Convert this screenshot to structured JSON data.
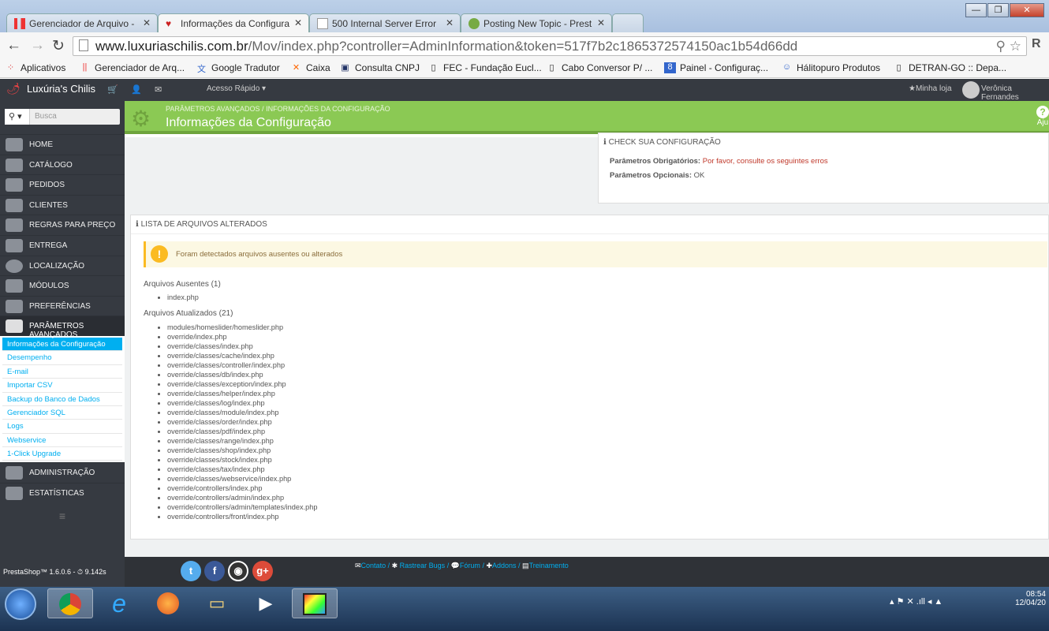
{
  "browser": {
    "tabs": [
      {
        "title": "Gerenciador de Arquivo -",
        "active": false
      },
      {
        "title": "Informações da Configura",
        "active": true
      },
      {
        "title": "500 Internal Server Error",
        "active": false
      },
      {
        "title": "Posting New Topic - Prest",
        "active": false
      }
    ],
    "url_host": "www.luxuriaschilis.com.br",
    "url_path": "/Mov/index.php?controller=AdminInformation&token=517f7b2c1865372574150ac1b54d66dd",
    "bookmarks": [
      "Aplicativos",
      "Gerenciador de Arq...",
      "Google Tradutor",
      "Caixa",
      "Consulta CNPJ",
      "FEC - Fundação Eucl...",
      "Cabo Conversor P/ ...",
      "Painel - Configuraç...",
      "Hálitopuro Produtos",
      "DETRAN-GO :: Depa..."
    ]
  },
  "header": {
    "shop_name": "Luxúria's Chilis",
    "quick_access": "Acesso Rápido ▾",
    "my_shop": "Minha loja",
    "user": "Verônica Fernandes"
  },
  "sidebar": {
    "search_placeholder": "Busca",
    "items": [
      "HOME",
      "CATÁLOGO",
      "PEDIDOS",
      "CLIENTES",
      "REGRAS PARA PREÇO",
      "ENTREGA",
      "LOCALIZAÇÃO",
      "MÓDULOS",
      "PREFERÊNCIAS",
      "PARÂMETROS AVANÇADOS"
    ],
    "subitems": [
      "Informações da Configuração",
      "Desempenho",
      "E-mail",
      "Importar CSV",
      "Backup do Banco de Dados",
      "Gerenciador SQL",
      "Logs",
      "Webservice",
      "1-Click Upgrade"
    ],
    "items_after": [
      "ADMINISTRAÇÃO",
      "ESTATÍSTICAS"
    ]
  },
  "page": {
    "breadcrumb1": "PARÂMETROS AVANÇADOS",
    "breadcrumb_sep": "/",
    "breadcrumb2": "INFORMAÇÕES DA CONFIGURAÇÃO",
    "title": "Informações da Configuração",
    "help": "Aju",
    "check_title": "CHECK SUA CONFIGURAÇÃO",
    "required_label": "Parâmetros Obrigatórios:",
    "required_value": "Por favor, consulte os seguintes erros",
    "optional_label": "Parâmetros Opcionais:",
    "optional_value": "OK",
    "list_title": "LISTA DE ARQUIVOS ALTERADOS",
    "warning": "Foram detectados arquivos ausentes ou alterados",
    "missing_title": "Arquivos Ausentes (1)",
    "missing": [
      "index.php"
    ],
    "updated_title": "Arquivos Atualizados (21)",
    "updated": [
      "modules/homeslider/homeslider.php",
      "override/index.php",
      "override/classes/index.php",
      "override/classes/cache/index.php",
      "override/classes/controller/index.php",
      "override/classes/db/index.php",
      "override/classes/exception/index.php",
      "override/classes/helper/index.php",
      "override/classes/log/index.php",
      "override/classes/module/index.php",
      "override/classes/order/index.php",
      "override/classes/pdf/index.php",
      "override/classes/range/index.php",
      "override/classes/shop/index.php",
      "override/classes/stock/index.php",
      "override/classes/tax/index.php",
      "override/classes/webservice/index.php",
      "override/controllers/index.php",
      "override/controllers/admin/index.php",
      "override/controllers/admin/templates/index.php",
      "override/controllers/front/index.php"
    ]
  },
  "footer": {
    "version": "PrestaShop™ 1.6.0.6 - ⏱ 9.142s",
    "links": [
      "Contato",
      "Rastrear Bugs",
      "Fórum",
      "Addons",
      "Treinamento"
    ]
  },
  "taskbar": {
    "time": "08:54",
    "date": "12/04/20"
  }
}
